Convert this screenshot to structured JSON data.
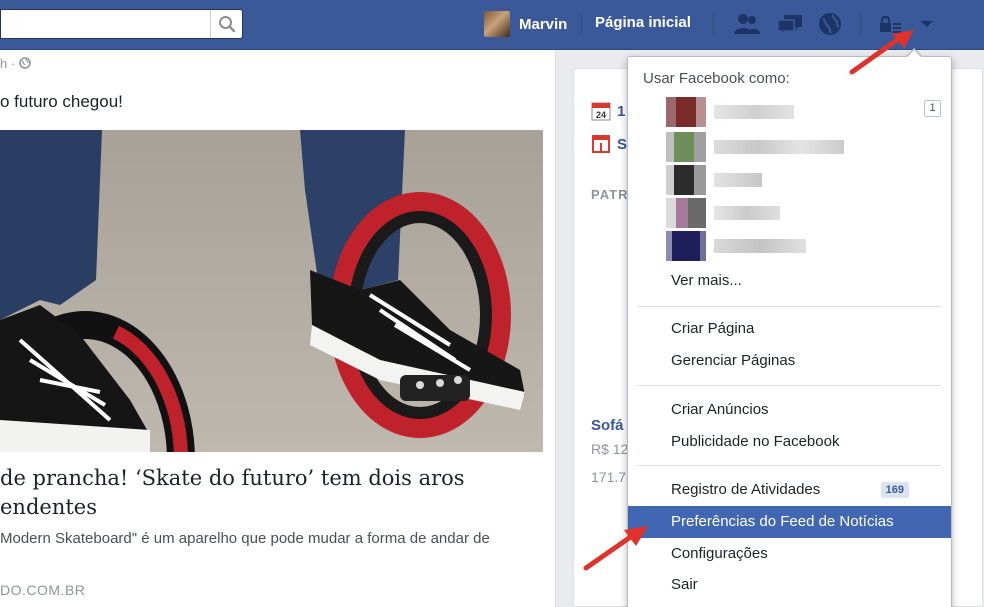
{
  "topbar": {
    "user_name": "Marvin",
    "home_label": "Página inicial",
    "icons": [
      "search-icon",
      "friend-requests-icon",
      "messages-icon",
      "notifications-icon",
      "privacy-shortcuts-icon",
      "account-menu-chevron-icon"
    ],
    "brand_color": "#3b5998"
  },
  "post": {
    "meta": "h ·",
    "text": "o futuro chegou!",
    "link_title": "de prancha! ‘Skate do futuro’ tem dois aros\nendentes",
    "link_desc": "Modern Skateboard\" é um aparelho que pode mudar a forma de andar de",
    "link_source": "DO.COM.BR"
  },
  "side": {
    "row1_text": "1",
    "row2_text": "S",
    "calendar_day": "24",
    "section_header": "PATR",
    "ad_title": "Sofá",
    "ad_price": "R$ 12",
    "ad_likes": "171.7"
  },
  "menu": {
    "header": "Usar Facebook como:",
    "pages": [
      {
        "badge": "1"
      },
      {
        "badge": ""
      },
      {
        "badge": ""
      },
      {
        "badge": ""
      },
      {
        "badge": ""
      }
    ],
    "see_more": "Ver mais...",
    "group1": [
      "Criar Página",
      "Gerenciar Páginas"
    ],
    "group2": [
      "Criar Anúncios",
      "Publicidade no Facebook"
    ],
    "group3": [
      {
        "label": "Registro de Atividades",
        "badge": "169"
      },
      {
        "label": "Preferências do Feed de Notícias",
        "active": true
      },
      {
        "label": "Configurações"
      },
      {
        "label": "Sair"
      }
    ],
    "highlight_color": "#4267b2"
  }
}
